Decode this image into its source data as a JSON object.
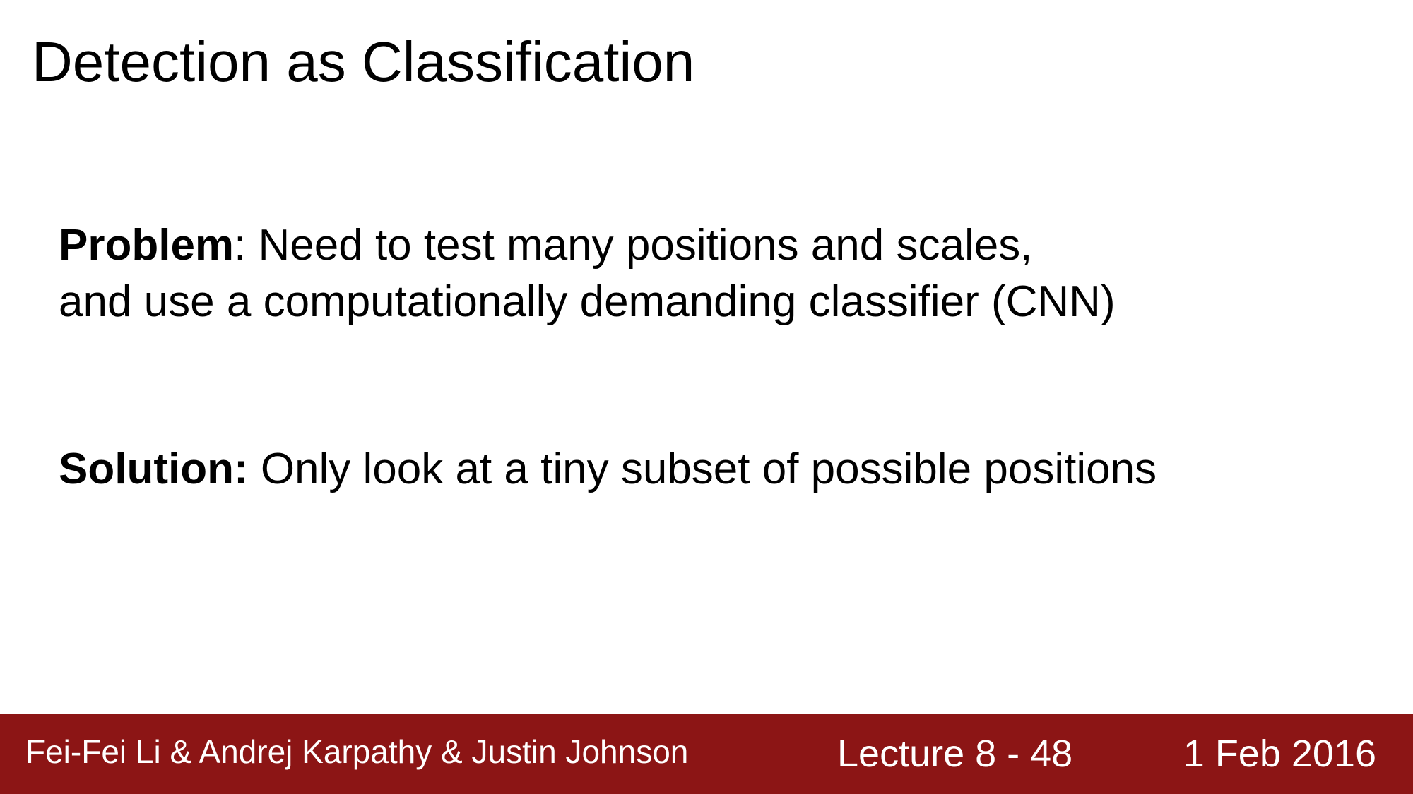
{
  "slide": {
    "title": "Detection as Classification",
    "problem": {
      "label": "Problem",
      "line1": ": Need to test many positions and scales,",
      "line2": "and use a computationally demanding classifier (CNN)"
    },
    "solution": {
      "label": "Solution:",
      "text": " Only look at a tiny subset of possible positions"
    }
  },
  "footer": {
    "authors": "Fei-Fei Li & Andrej Karpathy & Justin Johnson",
    "lecture": "Lecture 8 - 48",
    "date": "1 Feb 2016"
  },
  "colors": {
    "footer_background": "#8c1515",
    "footer_text": "#ffffff",
    "text": "#000000"
  }
}
